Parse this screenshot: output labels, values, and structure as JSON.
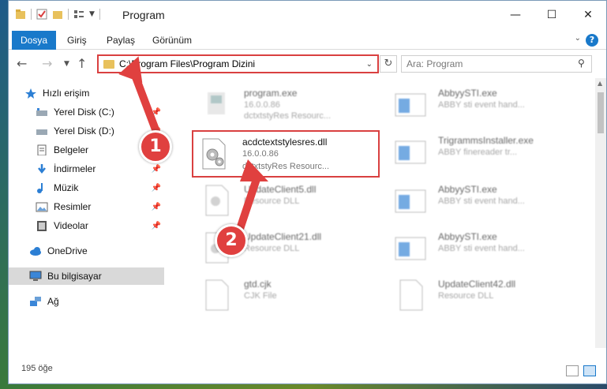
{
  "window": {
    "title": "Program",
    "controls": {
      "minimize": "—",
      "maximize": "☐",
      "close": "✕"
    }
  },
  "ribbon": {
    "tabs": [
      {
        "label": "Dosya"
      },
      {
        "label": "Giriş"
      },
      {
        "label": "Paylaş"
      },
      {
        "label": "Görünüm"
      }
    ],
    "help": "?"
  },
  "nav": {
    "address_path": "C:\\Program Files\\Program Dizini",
    "search_placeholder": "Ara: Program"
  },
  "sidebar": {
    "items": [
      {
        "label": "Hızlı erişim",
        "icon": "star-icon",
        "pinned": false
      },
      {
        "label": "Yerel Disk (C:)",
        "icon": "drive-icon",
        "pinned": true
      },
      {
        "label": "Yerel Disk (D:)",
        "icon": "drive-icon",
        "pinned": true
      },
      {
        "label": "Belgeler",
        "icon": "documents-icon",
        "pinned": true
      },
      {
        "label": "İndirmeler",
        "icon": "download-icon",
        "pinned": true
      },
      {
        "label": "Müzik",
        "icon": "music-icon",
        "pinned": true
      },
      {
        "label": "Resimler",
        "icon": "pictures-icon",
        "pinned": true
      },
      {
        "label": "Videolar",
        "icon": "video-icon",
        "pinned": true
      },
      {
        "label": "OneDrive",
        "icon": "cloud-icon",
        "pinned": false
      },
      {
        "label": "Bu bilgisayar",
        "icon": "computer-icon",
        "pinned": false
      },
      {
        "label": "Ağ",
        "icon": "network-icon",
        "pinned": false
      }
    ]
  },
  "files": {
    "col1": [
      {
        "name": "program.exe",
        "line2": "16.0.0.86",
        "line3": "dctxtstyRes Resourc..."
      },
      {
        "name": "acdctextstylesres.dll",
        "line2": "16.0.0.86",
        "line3": "dctxtstyRes Resourc..."
      },
      {
        "name": "UpdateClient5.dll",
        "line2": "Resource DLL",
        "line3": ""
      },
      {
        "name": "UpdateClient21.dll",
        "line2": "Resource DLL",
        "line3": ""
      },
      {
        "name": "gtd.cjk",
        "line2": "CJK File",
        "line3": ""
      }
    ],
    "col2": [
      {
        "name": "AbbyySTI.exe",
        "line2": "ABBY sti event hand...",
        "line3": ""
      },
      {
        "name": "TrigrammsInstaller.exe",
        "line2": "ABBY finereader tr...",
        "line3": ""
      },
      {
        "name": "AbbyySTI.exe",
        "line2": "ABBY sti event hand...",
        "line3": ""
      },
      {
        "name": "AbbyySTI.exe",
        "line2": "ABBY sti event hand...",
        "line3": ""
      },
      {
        "name": "UpdateClient42.dll",
        "line2": "Resource DLL",
        "line3": ""
      }
    ]
  },
  "status": {
    "count": "195 öğe"
  },
  "annotations": {
    "badge1": "1",
    "badge2": "2"
  },
  "colors": {
    "accent": "#1979ca",
    "highlight": "#d94040",
    "badge": "#e0403f"
  }
}
